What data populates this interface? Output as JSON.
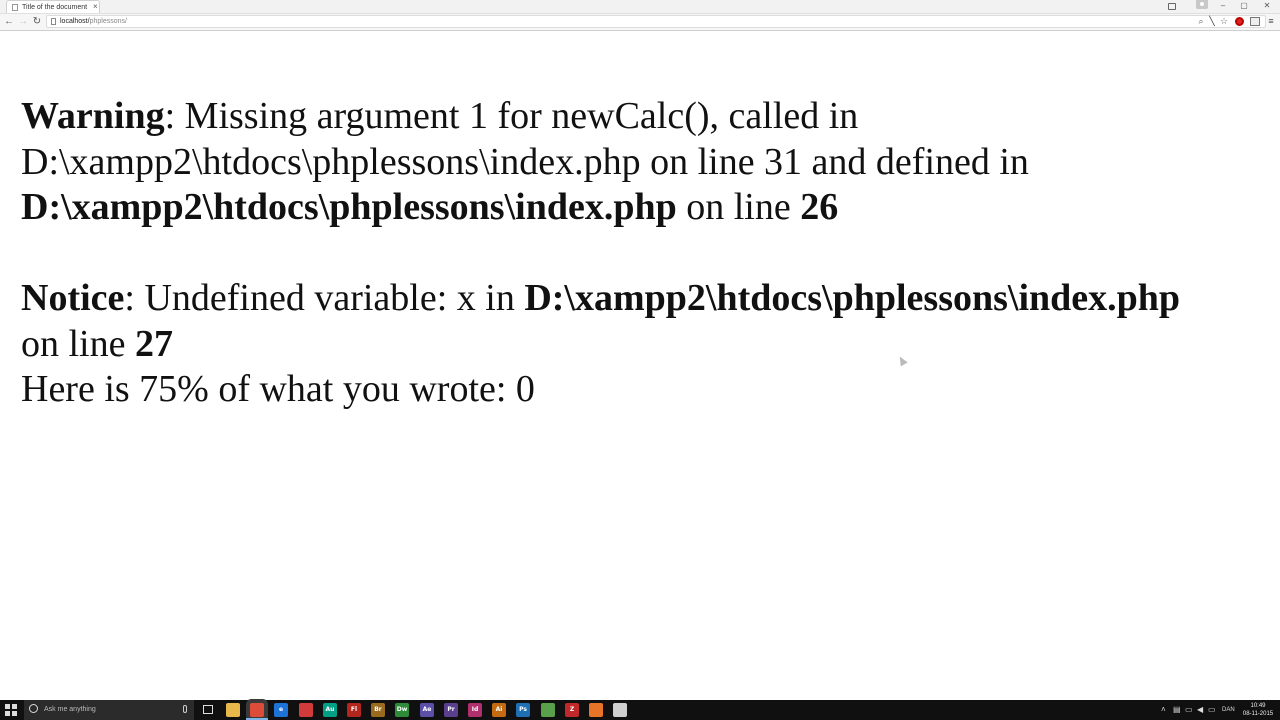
{
  "browser": {
    "tab_title": "Title of the document",
    "tab_close": "×",
    "url_host": "localhost/",
    "url_path": "phplessons/",
    "window_controls": [
      "–",
      "▢",
      "✕"
    ],
    "icons": [
      "back-arrow-icon",
      "forward-arrow-icon",
      "reload-icon",
      "page-icon",
      "zoom-icon",
      "bookmark-star-icon",
      "menu-icon"
    ]
  },
  "page": {
    "warning_label": "Warning",
    "warning_text_1": ": Missing argument 1 for newCalc(), called in",
    "warning_text_2": "D:\\xampp2\\htdocs\\phplessons\\index.php on line 31 and defined in",
    "warning_path": "D:\\xampp2\\htdocs\\phplessons\\index.php",
    "warning_on_line": " on line ",
    "warning_line": "26",
    "notice_label": "Notice",
    "notice_text": ": Undefined variable: x in ",
    "notice_path": "D:\\xampp2\\htdocs\\phplessons\\index.php",
    "notice_on_line": "on line ",
    "notice_line": "27",
    "result_text": "Here is 75% of what you wrote: 0"
  },
  "taskbar": {
    "search_placeholder": "Ask me anything",
    "language": "DAN",
    "time": "10:49",
    "date": "08-11-2015",
    "apps": [
      {
        "name": "file-explorer-icon",
        "label": "",
        "color": "#e8b84a"
      },
      {
        "name": "chrome-icon",
        "label": "",
        "color": "#dd4b39"
      },
      {
        "name": "edge-icon",
        "label": "e",
        "color": "#1e73d9"
      },
      {
        "name": "creative-cloud-icon",
        "label": "",
        "color": "#d23b3b"
      },
      {
        "name": "audition-icon",
        "label": "Au",
        "color": "#00a085"
      },
      {
        "name": "flash-icon",
        "label": "Fl",
        "color": "#b3261e"
      },
      {
        "name": "bridge-icon",
        "label": "Br",
        "color": "#9a6b1e"
      },
      {
        "name": "dreamweaver-icon",
        "label": "Dw",
        "color": "#2e8b3a"
      },
      {
        "name": "after-effects-icon",
        "label": "Ae",
        "color": "#5b4fa8"
      },
      {
        "name": "premiere-icon",
        "label": "Pr",
        "color": "#5b3f8f"
      },
      {
        "name": "indesign-icon",
        "label": "Id",
        "color": "#b0306e"
      },
      {
        "name": "illustrator-icon",
        "label": "Ai",
        "color": "#c46b12"
      },
      {
        "name": "photoshop-icon",
        "label": "Ps",
        "color": "#1f6fb5"
      },
      {
        "name": "app-cube-icon",
        "label": "",
        "color": "#5aa04a"
      },
      {
        "name": "filezilla-icon",
        "label": "Z",
        "color": "#c0282a"
      },
      {
        "name": "xampp-icon",
        "label": "",
        "color": "#e8742a"
      },
      {
        "name": "notes-icon",
        "label": "",
        "color": "#cfcfcf"
      }
    ]
  }
}
